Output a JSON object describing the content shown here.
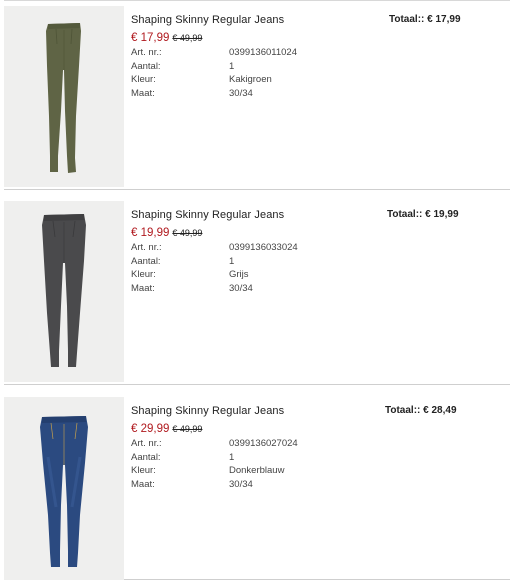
{
  "items": [
    {
      "name": "Shaping Skinny Regular Jeans",
      "price": "€ 17,99",
      "old_price": "€ 49,99",
      "total": "Totaal:: € 17,99",
      "details": [
        {
          "label": "Art. nr.:",
          "value": "0399136011024"
        },
        {
          "label": "Aantal:",
          "value": "1"
        },
        {
          "label": "Kleur:",
          "value": "Kakigroen"
        },
        {
          "label": "Maat:",
          "value": "30/34"
        }
      ],
      "image_color": "#5f6445",
      "image_name": "khaki-jeans-image"
    },
    {
      "name": "Shaping Skinny Regular Jeans",
      "price": "€ 19,99",
      "old_price": "€ 49,99",
      "total": "Totaal:: € 19,99",
      "details": [
        {
          "label": "Art. nr.:",
          "value": "0399136033024"
        },
        {
          "label": "Aantal:",
          "value": "1"
        },
        {
          "label": "Kleur:",
          "value": "Grijs"
        },
        {
          "label": "Maat:",
          "value": "30/34"
        }
      ],
      "image_color": "#4a4a4c",
      "image_name": "grey-jeans-image"
    },
    {
      "name": "Shaping Skinny Regular Jeans",
      "price": "€ 29,99",
      "old_price": "€ 49,99",
      "total": "Totaal:: € 28,49",
      "details": [
        {
          "label": "Art. nr.:",
          "value": "0399136027024"
        },
        {
          "label": "Aantal:",
          "value": "1"
        },
        {
          "label": "Kleur:",
          "value": "Donkerblauw"
        },
        {
          "label": "Maat:",
          "value": "30/34"
        }
      ],
      "image_color": "#2b4a80",
      "image_name": "blue-jeans-image"
    }
  ],
  "colors": {
    "sale_price": "#b0191e",
    "divider": "#cfcfcf",
    "image_background": "#efefee"
  }
}
